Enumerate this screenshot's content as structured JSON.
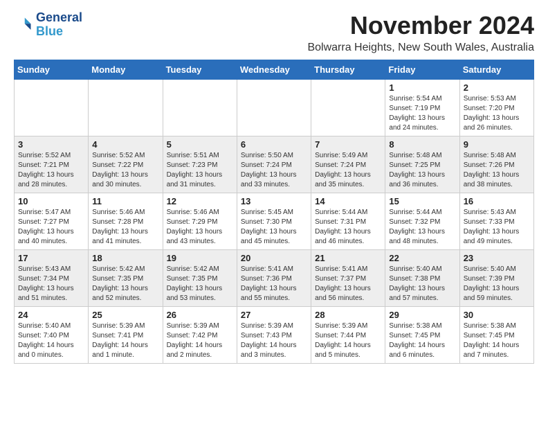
{
  "logo": {
    "line1": "General",
    "line2": "Blue"
  },
  "title": "November 2024",
  "subtitle": "Bolwarra Heights, New South Wales, Australia",
  "weekdays": [
    "Sunday",
    "Monday",
    "Tuesday",
    "Wednesday",
    "Thursday",
    "Friday",
    "Saturday"
  ],
  "weeks": [
    [
      {
        "day": "",
        "info": ""
      },
      {
        "day": "",
        "info": ""
      },
      {
        "day": "",
        "info": ""
      },
      {
        "day": "",
        "info": ""
      },
      {
        "day": "",
        "info": ""
      },
      {
        "day": "1",
        "info": "Sunrise: 5:54 AM\nSunset: 7:19 PM\nDaylight: 13 hours\nand 24 minutes."
      },
      {
        "day": "2",
        "info": "Sunrise: 5:53 AM\nSunset: 7:20 PM\nDaylight: 13 hours\nand 26 minutes."
      }
    ],
    [
      {
        "day": "3",
        "info": "Sunrise: 5:52 AM\nSunset: 7:21 PM\nDaylight: 13 hours\nand 28 minutes."
      },
      {
        "day": "4",
        "info": "Sunrise: 5:52 AM\nSunset: 7:22 PM\nDaylight: 13 hours\nand 30 minutes."
      },
      {
        "day": "5",
        "info": "Sunrise: 5:51 AM\nSunset: 7:23 PM\nDaylight: 13 hours\nand 31 minutes."
      },
      {
        "day": "6",
        "info": "Sunrise: 5:50 AM\nSunset: 7:24 PM\nDaylight: 13 hours\nand 33 minutes."
      },
      {
        "day": "7",
        "info": "Sunrise: 5:49 AM\nSunset: 7:24 PM\nDaylight: 13 hours\nand 35 minutes."
      },
      {
        "day": "8",
        "info": "Sunrise: 5:48 AM\nSunset: 7:25 PM\nDaylight: 13 hours\nand 36 minutes."
      },
      {
        "day": "9",
        "info": "Sunrise: 5:48 AM\nSunset: 7:26 PM\nDaylight: 13 hours\nand 38 minutes."
      }
    ],
    [
      {
        "day": "10",
        "info": "Sunrise: 5:47 AM\nSunset: 7:27 PM\nDaylight: 13 hours\nand 40 minutes."
      },
      {
        "day": "11",
        "info": "Sunrise: 5:46 AM\nSunset: 7:28 PM\nDaylight: 13 hours\nand 41 minutes."
      },
      {
        "day": "12",
        "info": "Sunrise: 5:46 AM\nSunset: 7:29 PM\nDaylight: 13 hours\nand 43 minutes."
      },
      {
        "day": "13",
        "info": "Sunrise: 5:45 AM\nSunset: 7:30 PM\nDaylight: 13 hours\nand 45 minutes."
      },
      {
        "day": "14",
        "info": "Sunrise: 5:44 AM\nSunset: 7:31 PM\nDaylight: 13 hours\nand 46 minutes."
      },
      {
        "day": "15",
        "info": "Sunrise: 5:44 AM\nSunset: 7:32 PM\nDaylight: 13 hours\nand 48 minutes."
      },
      {
        "day": "16",
        "info": "Sunrise: 5:43 AM\nSunset: 7:33 PM\nDaylight: 13 hours\nand 49 minutes."
      }
    ],
    [
      {
        "day": "17",
        "info": "Sunrise: 5:43 AM\nSunset: 7:34 PM\nDaylight: 13 hours\nand 51 minutes."
      },
      {
        "day": "18",
        "info": "Sunrise: 5:42 AM\nSunset: 7:35 PM\nDaylight: 13 hours\nand 52 minutes."
      },
      {
        "day": "19",
        "info": "Sunrise: 5:42 AM\nSunset: 7:35 PM\nDaylight: 13 hours\nand 53 minutes."
      },
      {
        "day": "20",
        "info": "Sunrise: 5:41 AM\nSunset: 7:36 PM\nDaylight: 13 hours\nand 55 minutes."
      },
      {
        "day": "21",
        "info": "Sunrise: 5:41 AM\nSunset: 7:37 PM\nDaylight: 13 hours\nand 56 minutes."
      },
      {
        "day": "22",
        "info": "Sunrise: 5:40 AM\nSunset: 7:38 PM\nDaylight: 13 hours\nand 57 minutes."
      },
      {
        "day": "23",
        "info": "Sunrise: 5:40 AM\nSunset: 7:39 PM\nDaylight: 13 hours\nand 59 minutes."
      }
    ],
    [
      {
        "day": "24",
        "info": "Sunrise: 5:40 AM\nSunset: 7:40 PM\nDaylight: 14 hours\nand 0 minutes."
      },
      {
        "day": "25",
        "info": "Sunrise: 5:39 AM\nSunset: 7:41 PM\nDaylight: 14 hours\nand 1 minute."
      },
      {
        "day": "26",
        "info": "Sunrise: 5:39 AM\nSunset: 7:42 PM\nDaylight: 14 hours\nand 2 minutes."
      },
      {
        "day": "27",
        "info": "Sunrise: 5:39 AM\nSunset: 7:43 PM\nDaylight: 14 hours\nand 3 minutes."
      },
      {
        "day": "28",
        "info": "Sunrise: 5:39 AM\nSunset: 7:44 PM\nDaylight: 14 hours\nand 5 minutes."
      },
      {
        "day": "29",
        "info": "Sunrise: 5:38 AM\nSunset: 7:45 PM\nDaylight: 14 hours\nand 6 minutes."
      },
      {
        "day": "30",
        "info": "Sunrise: 5:38 AM\nSunset: 7:45 PM\nDaylight: 14 hours\nand 7 minutes."
      }
    ]
  ]
}
